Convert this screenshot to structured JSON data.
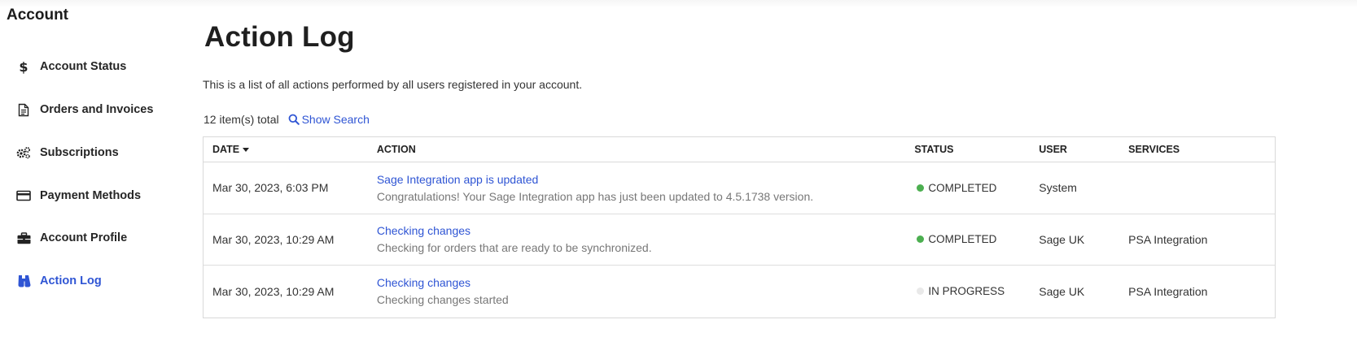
{
  "sidebar": {
    "title": "Account",
    "items": [
      {
        "label": "Account Status",
        "icon": "dollar-icon"
      },
      {
        "label": "Orders and Invoices",
        "icon": "document-icon"
      },
      {
        "label": "Subscriptions",
        "icon": "gears-icon"
      },
      {
        "label": "Payment Methods",
        "icon": "credit-card-icon"
      },
      {
        "label": "Account Profile",
        "icon": "briefcase-icon"
      },
      {
        "label": "Action Log",
        "icon": "binoculars-icon",
        "active": true
      }
    ]
  },
  "page": {
    "title": "Action Log",
    "description": "This is a list of all actions performed by all users registered in your account.",
    "total": "12 item(s) total",
    "show_search": "Show Search"
  },
  "table": {
    "headers": {
      "date": "DATE",
      "action": "ACTION",
      "status": "STATUS",
      "user": "USER",
      "services": "SERVICES"
    },
    "rows": [
      {
        "date": "Mar 30, 2023, 6:03 PM",
        "action_title": "Sage Integration app is updated",
        "action_detail": "Congratulations! Your Sage Integration app has just been updated to 4.5.1738 version.",
        "status": "COMPLETED",
        "status_color": "#4caf50",
        "user": "System",
        "services": ""
      },
      {
        "date": "Mar 30, 2023, 10:29 AM",
        "action_title": "Checking changes",
        "action_detail": "Checking for orders that are ready to be synchronized.",
        "status": "COMPLETED",
        "status_color": "#4caf50",
        "user": "Sage UK",
        "services": "PSA Integration"
      },
      {
        "date": "Mar 30, 2023, 10:29 AM",
        "action_title": "Checking changes",
        "action_detail": "Checking changes started",
        "status": "IN PROGRESS",
        "status_color": "#e9e9e9",
        "user": "Sage UK",
        "services": "PSA Integration"
      }
    ]
  },
  "colors": {
    "accent": "#2f55d4",
    "completed": "#4caf50",
    "in_progress": "#e9e9e9"
  }
}
